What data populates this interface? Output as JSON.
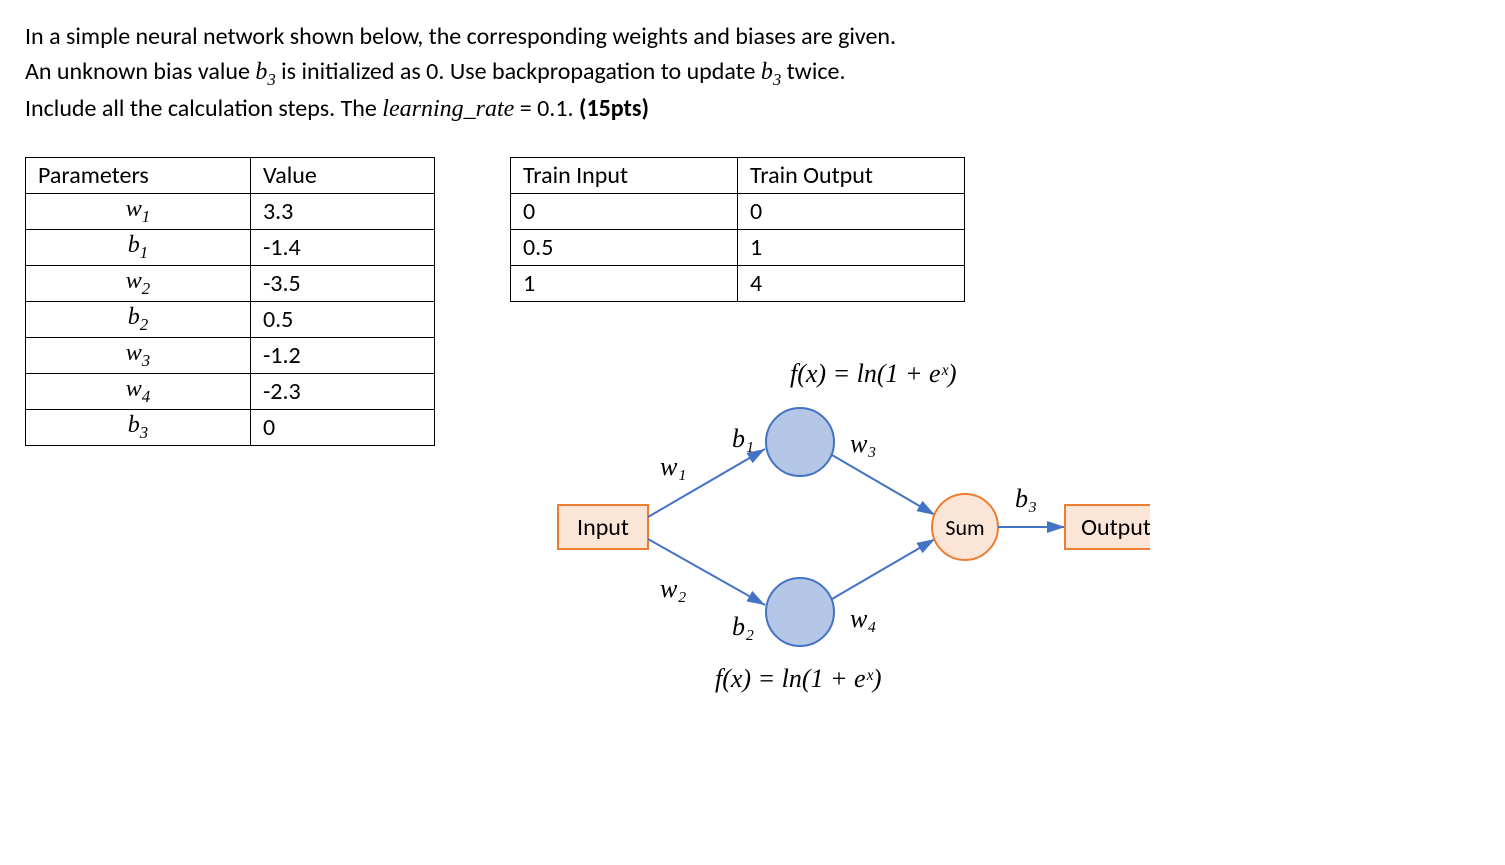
{
  "prose": {
    "line1a": "In a simple neural network shown below, the corresponding weights and biases are given.",
    "line2a": "An unknown bias value ",
    "line2_b3": "b",
    "line2_b3sub": "3",
    "line2b": " is initialized as 0. Use backpropagation to update ",
    "line2c": " twice.",
    "line3a": "Include all the calculation steps. The ",
    "lr_word": "learning_rate",
    "eq": " = ",
    "lr_val": "0.1",
    "period": ". ",
    "pts": "(15pts)"
  },
  "param_table": {
    "h1": "Parameters",
    "h2": "Value",
    "rows": [
      {
        "p": "w",
        "sub": "1",
        "v": "3.3"
      },
      {
        "p": "b",
        "sub": "1",
        "v": "-1.4"
      },
      {
        "p": "w",
        "sub": "2",
        "v": "-3.5"
      },
      {
        "p": "b",
        "sub": "2",
        "v": "0.5"
      },
      {
        "p": "w",
        "sub": "3",
        "v": "-1.2"
      },
      {
        "p": "w",
        "sub": "4",
        "v": "-2.3"
      },
      {
        "p": "b",
        "sub": "3",
        "v": "0"
      }
    ]
  },
  "train_table": {
    "h1": "Train Input",
    "h2": "Train Output",
    "rows": [
      {
        "in": "0",
        "out": "0"
      },
      {
        "in": "0.5",
        "out": "1"
      },
      {
        "in": "1",
        "out": "4"
      }
    ]
  },
  "diagram": {
    "fx_top": "f(x) = ln(1 + eˣ)",
    "fx_bot": "f(x) = ln(1 + eˣ)",
    "input": "Input",
    "sum": "Sum",
    "output": "Output",
    "w1": "w₁",
    "w2": "w₂",
    "w3": "w₃",
    "w4": "w₄",
    "b1": "b₁",
    "b2": "b₂",
    "b3": "b₃"
  }
}
